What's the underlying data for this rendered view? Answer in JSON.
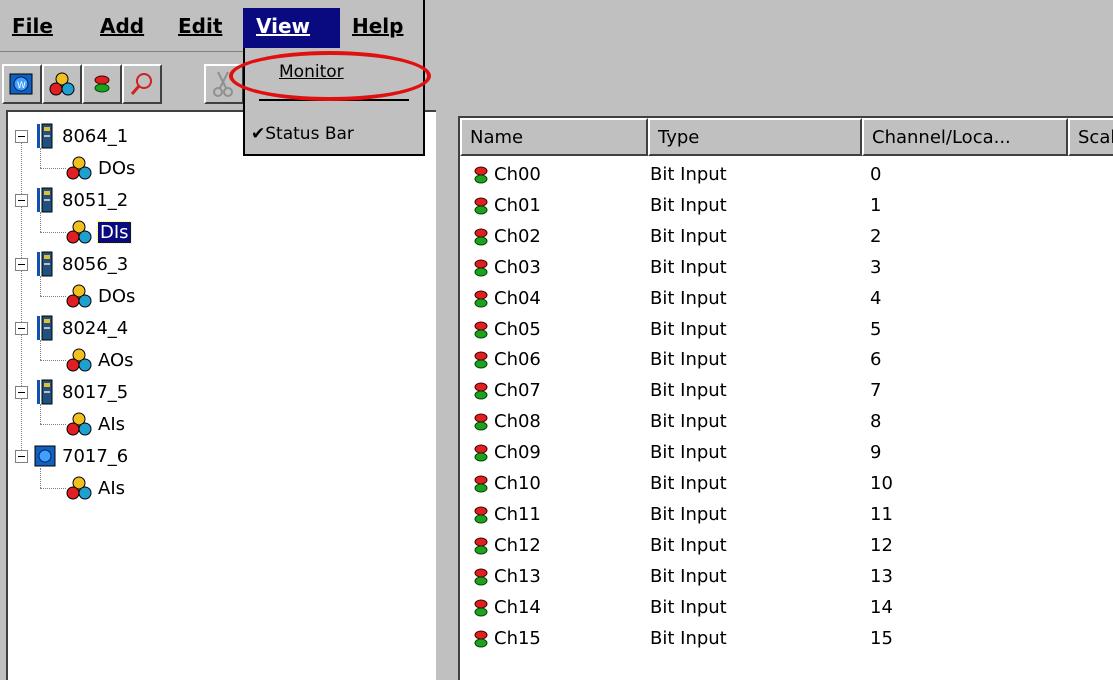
{
  "menu": {
    "file": "File",
    "add": "Add",
    "edit": "Edit",
    "view": "View",
    "help": "Help"
  },
  "toolbar": {
    "buttons": [
      "module-icon",
      "tags-icon",
      "bit-io-icon",
      "search-icon",
      "cut-icon"
    ]
  },
  "view_menu": {
    "items": [
      {
        "label": "Monitor",
        "checked": false
      },
      {
        "label": "Status Bar",
        "checked": true
      }
    ],
    "checkmark": "✔",
    "highlight_color": "#e01010"
  },
  "tree": {
    "nodes": [
      {
        "label": "8064_1",
        "child": "DOs"
      },
      {
        "label": "8051_2",
        "child": "DIs",
        "child_selected": true
      },
      {
        "label": "8056_3",
        "child": "DOs"
      },
      {
        "label": "8024_4",
        "child": "AOs"
      },
      {
        "label": "8017_5",
        "child": "AIs"
      },
      {
        "label": "7017_6",
        "child": "AIs"
      }
    ]
  },
  "list": {
    "columns": [
      "Name",
      "Type",
      "Channel/Loca...",
      "Scal"
    ],
    "rows": [
      {
        "name": "Ch00",
        "type": "Bit Input",
        "channel": "0"
      },
      {
        "name": "Ch01",
        "type": "Bit Input",
        "channel": "1"
      },
      {
        "name": "Ch02",
        "type": "Bit Input",
        "channel": "2"
      },
      {
        "name": "Ch03",
        "type": "Bit Input",
        "channel": "3"
      },
      {
        "name": "Ch04",
        "type": "Bit Input",
        "channel": "4"
      },
      {
        "name": "Ch05",
        "type": "Bit Input",
        "channel": "5"
      },
      {
        "name": "Ch06",
        "type": "Bit Input",
        "channel": "6"
      },
      {
        "name": "Ch07",
        "type": "Bit Input",
        "channel": "7"
      },
      {
        "name": "Ch08",
        "type": "Bit Input",
        "channel": "8"
      },
      {
        "name": "Ch09",
        "type": "Bit Input",
        "channel": "9"
      },
      {
        "name": "Ch10",
        "type": "Bit Input",
        "channel": "10"
      },
      {
        "name": "Ch11",
        "type": "Bit Input",
        "channel": "11"
      },
      {
        "name": "Ch12",
        "type": "Bit Input",
        "channel": "12"
      },
      {
        "name": "Ch13",
        "type": "Bit Input",
        "channel": "13"
      },
      {
        "name": "Ch14",
        "type": "Bit Input",
        "channel": "14"
      },
      {
        "name": "Ch15",
        "type": "Bit Input",
        "channel": "15"
      }
    ]
  }
}
